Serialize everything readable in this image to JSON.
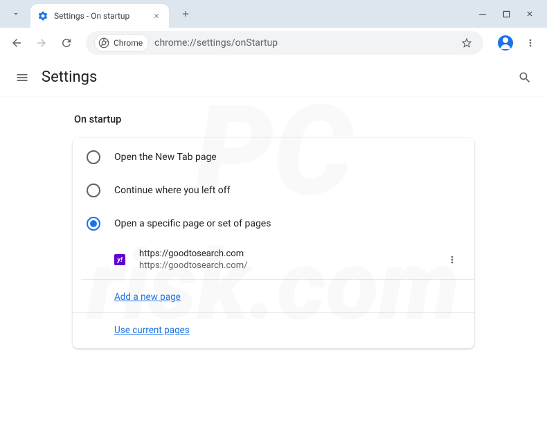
{
  "tab": {
    "title": "Settings - On startup"
  },
  "omnibox": {
    "chip_label": "Chrome",
    "url": "chrome://settings/onStartup"
  },
  "settings": {
    "title": "Settings"
  },
  "section": {
    "title": "On startup"
  },
  "options": {
    "new_tab": "Open the New Tab page",
    "continue": "Continue where you left off",
    "specific": "Open a specific page or set of pages"
  },
  "pages": [
    {
      "label": "https://goodtosearch.com",
      "url": "https://goodtosearch.com/",
      "favicon_text": "y!"
    }
  ],
  "links": {
    "add_page": "Add a new page",
    "use_current": "Use current pages"
  }
}
